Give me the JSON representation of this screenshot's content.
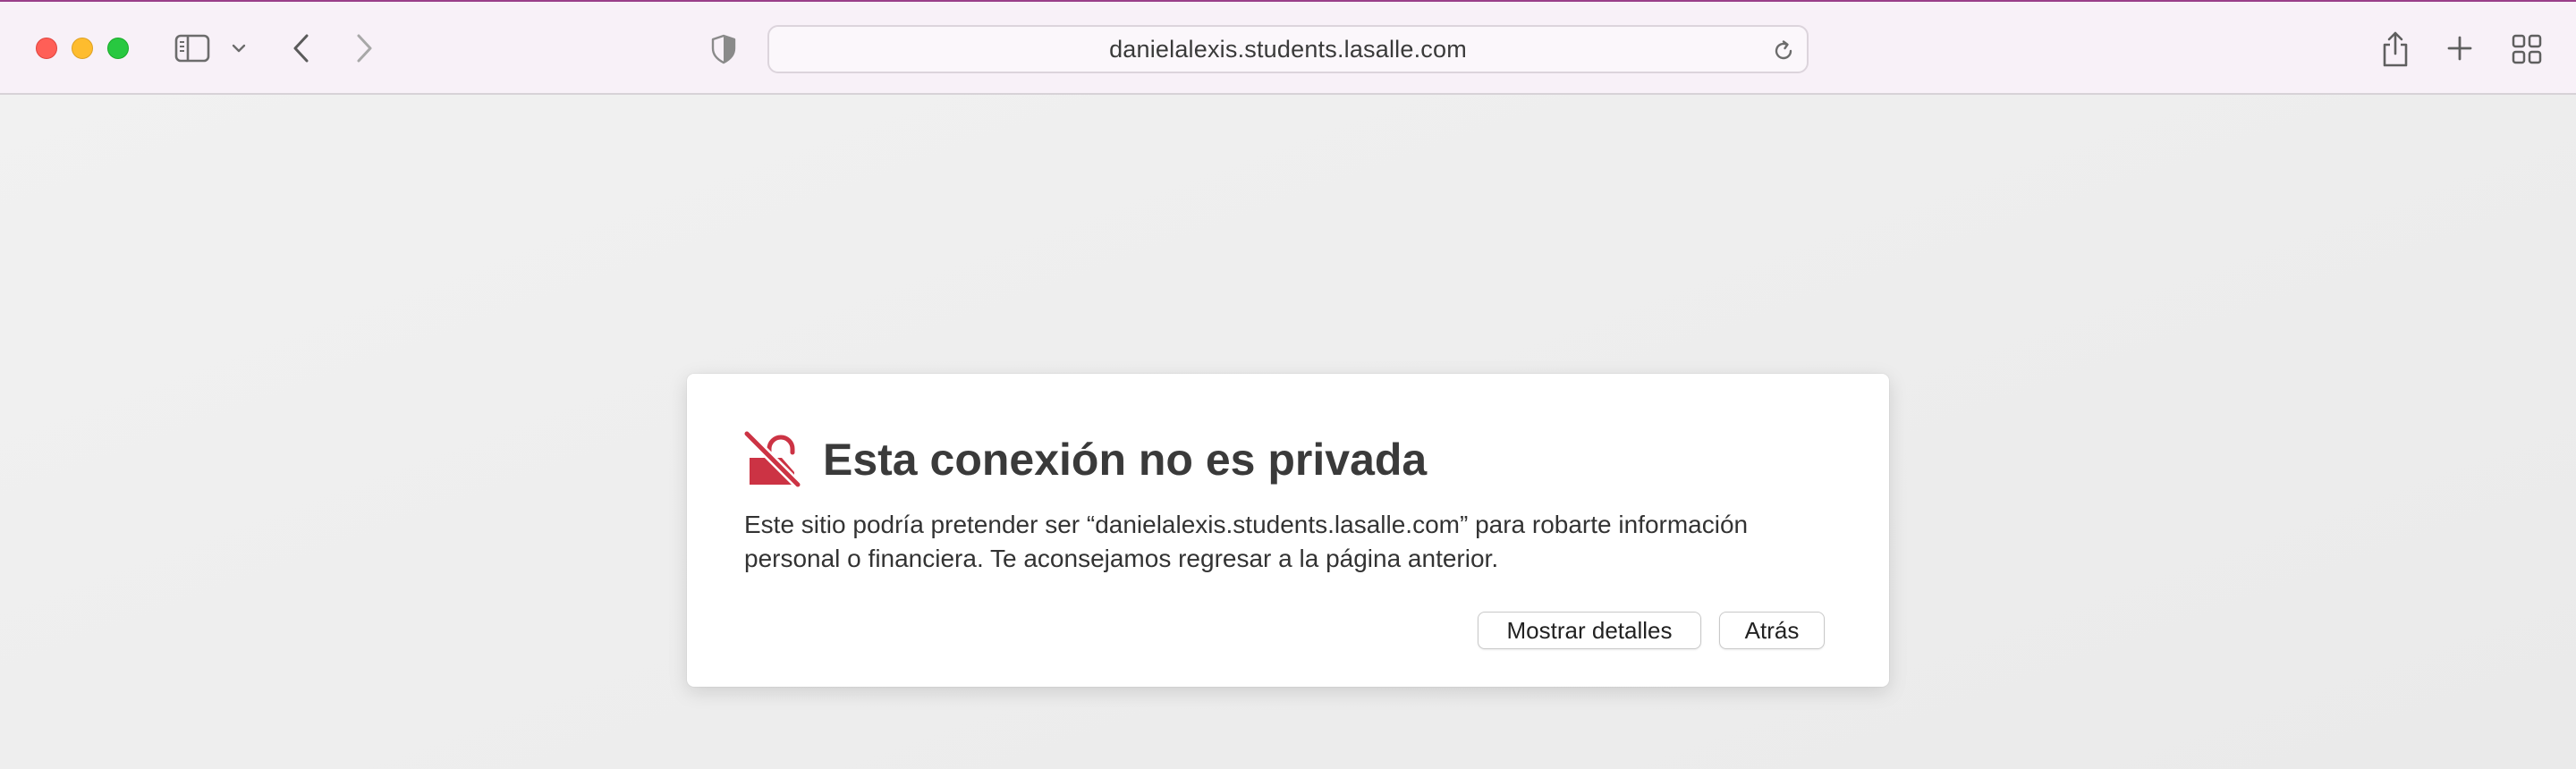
{
  "browser": {
    "address_bar": {
      "url_text": "danielalexis.students.lasalle.com"
    },
    "icons": {
      "sidebar": "sidebar-icon",
      "sidebar_menu": "chevron-down-icon",
      "back": "chevron-left-icon",
      "forward": "chevron-right-icon",
      "privacy": "shield-icon",
      "reload": "reload-icon",
      "share": "share-icon",
      "new_tab": "plus-icon",
      "tab_overview": "grid-icon"
    }
  },
  "warning": {
    "title": "Esta conexión no es privada",
    "body": "Este sitio podría pretender ser “danielalexis.students.lasalle.com” para robarte información personal o financiera. Te aconsejamos regresar a la página anterior.",
    "show_details_label": "Mostrar detalles",
    "back_label": "Atrás",
    "icon": "broken-lock-icon",
    "accent_color": "#cc3344"
  },
  "colors": {
    "toolbar_bg": "#f8f1f8",
    "toolbar_accent_top": "#9a3f8a",
    "page_bg": "#ebebeb",
    "traffic_red": "#ff5f57",
    "traffic_yellow": "#febc2e",
    "traffic_green": "#28c840"
  }
}
